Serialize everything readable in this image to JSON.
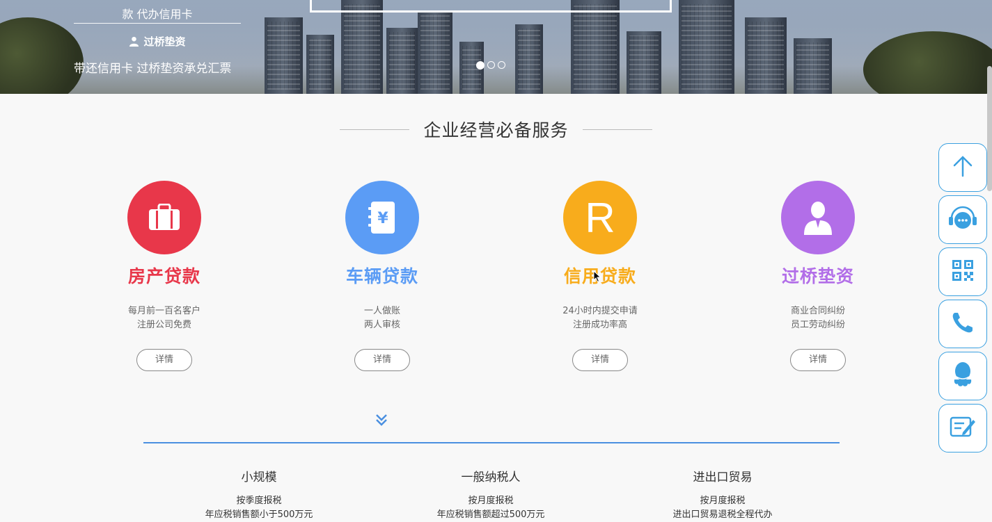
{
  "banner": {
    "line1": "款 代办信用卡",
    "line2": "过桥垫资",
    "line3": "带还信用卡 过桥垫资承兑汇票",
    "slides": 3,
    "active_slide": 1
  },
  "section": {
    "title": "企业经营必备服务"
  },
  "cards": [
    {
      "name": "房产贷款",
      "desc1": "每月前一百名客户",
      "desc2": "注册公司免费",
      "btn": "详情",
      "color": "#e8374a",
      "icon": "briefcase-icon"
    },
    {
      "name": "车辆贷款",
      "desc1": "一人做账",
      "desc2": "两人审核",
      "btn": "详情",
      "color": "#5b9cf5",
      "icon": "yuan-ledger-icon"
    },
    {
      "name": "信用贷款",
      "desc1": "24小时内提交申请",
      "desc2": "注册成功率高",
      "btn": "详情",
      "color": "#f8ac1c",
      "icon": "letter-r-icon",
      "icon_text": "R"
    },
    {
      "name": "过桥垫资",
      "desc1": "商业合同纠纷",
      "desc2": "员工劳动纠纷",
      "btn": "详情",
      "color": "#b26ee8",
      "icon": "businessman-icon"
    }
  ],
  "tax": [
    {
      "title": "小规模",
      "d1": "按季度报税",
      "d2": "年应税销售额小于500万元"
    },
    {
      "title": "一般纳税人",
      "d1": "按月度报税",
      "d2": "年应税销售额超过500万元"
    },
    {
      "title": "进出口贸易",
      "d1": "按月度报税",
      "d2": "进出口贸易退税全程代办"
    }
  ],
  "sidebar": [
    "back-to-top-icon",
    "customer-service-icon",
    "qr-code-icon",
    "phone-icon",
    "qq-icon",
    "message-edit-icon"
  ],
  "colors": {
    "accent_blue": "#4a8fe0",
    "sidebar_border": "#3aa0e0"
  }
}
